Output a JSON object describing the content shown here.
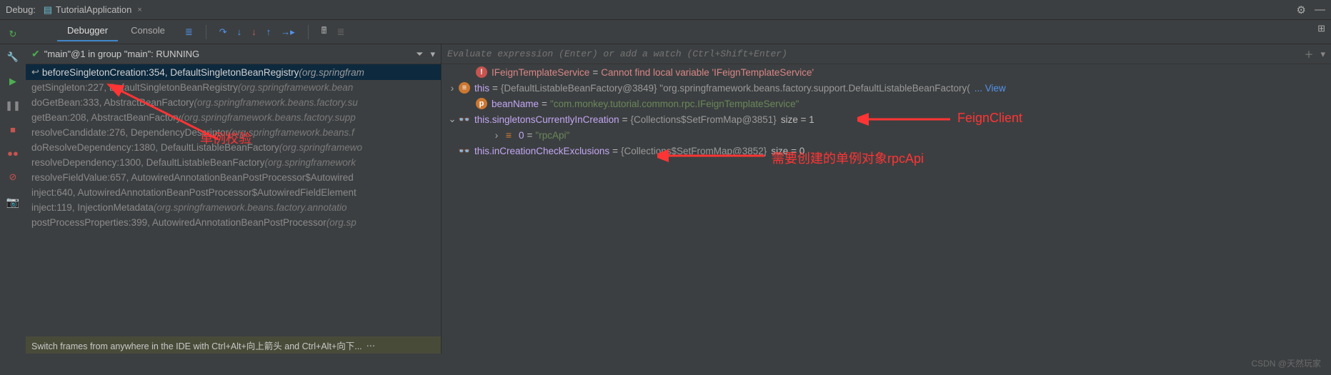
{
  "topbar": {
    "debug_label": "Debug:",
    "tab_title": "TutorialApplication",
    "close_x": "×"
  },
  "sub_tabs": {
    "debugger": "Debugger",
    "console": "Console"
  },
  "thread": {
    "text": "\"main\"@1 in group \"main\": RUNNING"
  },
  "frames": [
    {
      "selected": true,
      "has_back": true,
      "label": "beforeSingletonCreation:354, DefaultSingletonBeanRegistry",
      "pkg": "(org.springfram"
    },
    {
      "dim": true,
      "label": "getSingleton:227, DefaultSingletonBeanRegistry",
      "pkg": "(org.springframework.bean"
    },
    {
      "dim": true,
      "label": "doGetBean:333, AbstractBeanFactory",
      "pkg": "(org.springframework.beans.factory.su"
    },
    {
      "dim": true,
      "label": "getBean:208, AbstractBeanFactory",
      "pkg": "(org.springframework.beans.factory.supp"
    },
    {
      "dim": true,
      "label": "resolveCandidate:276, DependencyDescriptor",
      "pkg": "(org.springframework.beans.f"
    },
    {
      "dim": true,
      "label": "doResolveDependency:1380, DefaultListableBeanFactory",
      "pkg": "(org.springframewo"
    },
    {
      "dim": true,
      "label": "resolveDependency:1300, DefaultListableBeanFactory",
      "pkg": "(org.springframework"
    },
    {
      "dim": true,
      "label": "resolveFieldValue:657, AutowiredAnnotationBeanPostProcessor$Autowired",
      "pkg": ""
    },
    {
      "dim": true,
      "label": "inject:640, AutowiredAnnotationBeanPostProcessor$AutowiredFieldElement",
      "pkg": ""
    },
    {
      "dim": true,
      "label": "inject:119, InjectionMetadata",
      "pkg": "(org.springframework.beans.factory.annotatio"
    },
    {
      "dim": true,
      "label": "postProcessProperties:399, AutowiredAnnotationBeanPostProcessor",
      "pkg": "(org.sp"
    }
  ],
  "hint": "Switch frames from anywhere in the IDE with Ctrl+Alt+向上箭头 and Ctrl+Alt+向下...",
  "eval_placeholder": "Evaluate expression (Enter) or add a watch (Ctrl+Shift+Enter)",
  "vars": {
    "err_name": "IFeignTemplateService",
    "err_val": "Cannot find local variable 'IFeignTemplateService'",
    "this_name": "this",
    "this_type": "{DefaultListableBeanFactory@3849}",
    "this_str": "\"org.springframework.beans.factory.support.DefaultListableBeanFactory(",
    "view": "... View",
    "bean_name": "beanName",
    "bean_val": "\"com.monkey.tutorial.common.rpc.IFeignTemplateService\"",
    "sic_name": "this.singletonsCurrentlyInCreation",
    "sic_type": "{Collections$SetFromMap@3851}",
    "sic_size": "size = 1",
    "item0_name": "0",
    "item0_val": "\"rpcApi\"",
    "ice_name": "this.inCreationCheckExclusions",
    "ice_type": "{Collections$SetFromMap@3852}",
    "ice_size": "size = 0"
  },
  "annotations": {
    "a1": "单例校验",
    "a2": "FeignClient",
    "a3": "需要创建的单例对象rpcApi"
  },
  "watermark": "CSDN @天然玩家"
}
